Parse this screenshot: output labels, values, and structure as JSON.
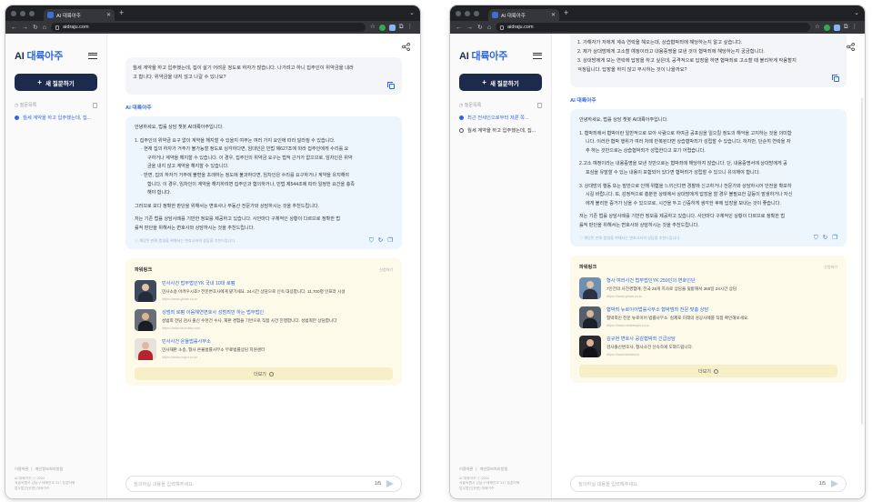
{
  "browser": {
    "tab_title": "AI 대륙아주",
    "url": "aidraju.com"
  },
  "app": {
    "logo_prefix": "AI ",
    "logo_name": "대륙아주",
    "new_question": "새 질문하기",
    "history_title": "질문목록",
    "footer_links": [
      "이용약관",
      "개인정보처리방침"
    ],
    "footer_lines": [
      "AI 대륙아주 ⓒ 2024",
      "서울특별시 강남구 테헤란로 317 동훈타워",
      "법무법인(유한) 대륙아주"
    ],
    "input_placeholder": "질의하실 내용을 입력해주세요.",
    "input_count": "1/5",
    "ai_label": "AI 대륙아주",
    "ai_note": "ⓘ 해당된 판례·법령을 위해서는 변호사와의 상담을 추천드립니다.",
    "more_label": "더보기",
    "power_title": "파워링크",
    "ad_label": "신청하기"
  },
  "win1": {
    "history": [
      {
        "text": "월세 계약을 하고 입주했는데, 집..."
      }
    ],
    "question": [
      "월세 계약을 하고 입주했는데, 집이 살기 어려운 정도로 하자가 많습니다. 나가려고 하니 집주인이 위약금을 내라",
      "고 합니다. 위약금을 내지 않고 나갈 수 있나요?"
    ],
    "answer": [
      {
        "t": "안녕하세요, 법률 상담 챗봇 AI대륙아주입니다.",
        "k": "p"
      },
      {
        "t": "1. 집주인의 위약금 요구 없이 계약을 해지할 수 있을지 여부는 여러 가지 요인에 따라 달라질 수 있습니다.",
        "k": "gap"
      },
      {
        "t": "· 현재 집의 하자가 거주가 불가능할 정도로 심각하다면, 임대인은 민법 제627조에 따라 집주인에게 수리를 요",
        "k": "bul"
      },
      {
        "t": "구하거나 계약을 해지할 수 있습니다. 이 경우, 집주인의 위약금 요구는 법적 근거가 없으므로, 임차인은 위약",
        "k": "bulc"
      },
      {
        "t": "금을 내지 않고 계약을 해지할 수 있습니다.",
        "k": "bulc"
      },
      {
        "t": "· 반면, 집의 하자가 거주에 불편을 초래하는 정도에 불과하다면, 임차인은 수리를 요구하거나 계약을 유지해야",
        "k": "bul"
      },
      {
        "t": "합니다. 이 경우, 임차인이 계약을 해지하려면 집주인과 협의하거나, 민법 제544조에 따라 일정한 요건을 충족",
        "k": "bulc"
      },
      {
        "t": "해야 합니다.",
        "k": "bulc"
      },
      {
        "t": "그러므로 보다 정확한 판단을 위해서는 변호사나 부동산 전문가와 상담하시는 것을 추천드립니다.",
        "k": "gap"
      },
      {
        "t": "저는 기존 법률 상담사례를 기반한 정보를 제공하고 있습니다. 사안마다 구체적인 상황이 다르므로 정확한 법",
        "k": "gap"
      },
      {
        "t": "률적 판단을 위해서는 변호사와 상담하시는 것을 추천드립니다.",
        "k": "p"
      }
    ],
    "lawyers": [
      {
        "name": "민사사건 법무법인YK 국내 10대 로펌",
        "desc": "민사소송 어려우시죠? 전문변호사에게 맡기세요. 24시간 상담으로 신속 대응합니다. 11,700평 인프라 시설",
        "url": "https://www.yklaw.co.kr",
        "bg": "#3e4a5e",
        "head": "#e5c3a2",
        "body": "#232a38"
      },
      {
        "name": "성범죄 로펌 이음해연변호사 성범죄만 하는 법무법인",
        "desc": "성범죄 전담 검사 출신 수천건 수사, 재판 경험을 기반으로 직접 사건 진행합니다. 성범죄만 상담합니다",
        "url": "https://www.ieumlaw.com",
        "bg": "#6a6f77",
        "head": "#d9b596",
        "body": "#1a1d24"
      },
      {
        "name": "민사사건 온율법률사무소",
        "desc": "민사재판 소송, 형사 온율법률사무소 무료법률상담 지원센터",
        "url": "https://www.onyul.co.kr",
        "bg": "#e9e2dc",
        "head": "#e1b89a",
        "body": "#b3262e"
      }
    ]
  },
  "win2": {
    "history": [
      {
        "text": "최근 전세인으로부터 저룬 쪽...",
        "active": true
      },
      {
        "text": "월세 계약을 하고 입주했는데, 집...",
        "active": false
      }
    ],
    "question": [
      "1. 가해자가 저에게 계속 연락을 해오는데, 상습협박죄에 해당하는지 알고 싶습니다.",
      "2. 제가 상대방에게 고소할 예정이라고 내용증명을 보낸 것이 협박죄에 해당하는지 궁금합니다.",
      "3. 상대방에게 모는 연락에 답장을 하고 싶은데, 공격적으로 답장을 하면 협박죄로 고소할 때 불리하게 작용할지",
      "걱정됩니다. 답장을 하지 않고 무시하는 것이 나을까요?"
    ],
    "answer": [
      {
        "t": "안녕하세요, 법률 상담 챗봇 AI대륙아주입니다.",
        "k": "p"
      },
      {
        "t": "1. 협박죄에서 협박이란 일반적으로 보아 사람으로 하여금 공포심을 일으킬 정도의 해악을 고지하는 것을 의미합",
        "k": "gap"
      },
      {
        "t": "니다. 이러한 협박 행위가 여러 차례 반복된다면 상습협박죄가 성립할 수 있습니다. 하지만, 단순히 연락을 자",
        "k": "ind"
      },
      {
        "t": "주 하는 것만으로는 상습협박죄가 성립한다고 보기 어렵습니다.",
        "k": "ind"
      },
      {
        "t": "2.고소 예정이라는 내용증명을 보낸 것만으로는 협박죄에 해당하지 않습니다. 단, 내용증명서에 상대방에게 공",
        "k": "gap"
      },
      {
        "t": "포심을 유발할 수 있는 내용이 포함되어 있다면 협박죄가 성립할 수 있으니 유의해야 합니다.",
        "k": "ind"
      },
      {
        "t": "3. 상대방의 행동 또는 말만으로 인해 위협을 느끼신다면 경찰에 신고하거나 전문가와 상담하시어 안전을 확보하",
        "k": "gap"
      },
      {
        "t": "시길 바랍니다. 또, 감정적으로 흥분한 상태에서 상대방에게 답장을 할 경우 불필요한 갈등이 발생하거나 자신",
        "k": "ind"
      },
      {
        "t": "에게 불리한 증거가 남을 수 있으므로, 시간을 두고 신중하게 생각한 후에 답장을 보내는 것이 좋습니다.",
        "k": "ind"
      },
      {
        "t": "저는 기존 법률 상담사례를 기반한 정보를 제공하고 있습니다. 사안마다 구체적인 상황이 다르므로 정확한 법",
        "k": "gap"
      },
      {
        "t": "률적 판단을 위해서는 변호사와 상담하시는 것을 추천드립니다.",
        "k": "p"
      }
    ],
    "lawyers": [
      {
        "name": "형사 여러사건 법무법인YK 250인의 변호인단",
        "desc": "7인건의 사건경험에, 전국 28개 지사로 상담을 뒷받해서 365일 24시간 상담",
        "url": "https://www.yklaw.co.kr",
        "bg": "#6f8fb3",
        "head": "#e4c2a4",
        "body": "#2a3346"
      },
      {
        "name": "협박죄 뉴로이어법률사무소 협박범죄 전문 맞춤 상담",
        "desc": "협박죄인 전문 뉴로이어 법률사무소. 실제로 미래의 성공사례를 직접 확인해보세요.",
        "url": "https://www.newlawyer.co.kr",
        "bg": "#55606e",
        "head": "#dcb697",
        "body": "#1c2028"
      },
      {
        "name": "김규현 변호사 공감협박죄 긴급상담",
        "desc": "검사출신변호사, 형사사건 신속하게 도와드립니다.",
        "url": "https://www.kimlaw.kr",
        "bg": "#2b2b31",
        "head": "#d8b291",
        "body": "#101216"
      }
    ]
  }
}
